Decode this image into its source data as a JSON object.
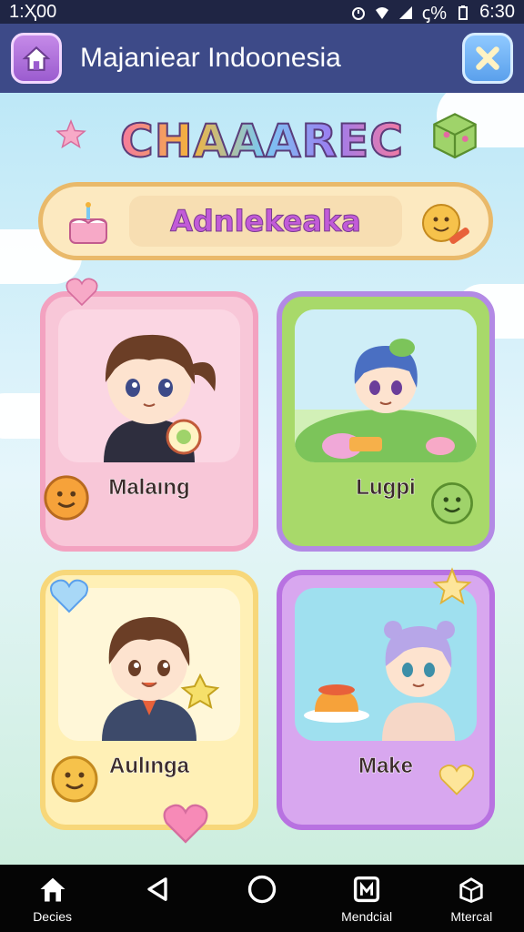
{
  "status_bar": {
    "time": "1:Ҳ00",
    "right_time": "6:30",
    "battery_text": "ꞔ%",
    "icons": [
      "alarm-icon",
      "wifi-icon",
      "signal-icon",
      "battery-icon"
    ]
  },
  "app_bar": {
    "title": "Majaniear Indoonesia",
    "home_icon": "home-icon",
    "close_icon": "close-icon"
  },
  "main": {
    "heading": "CHAAAREC",
    "banner_text": "Adnlekeaka",
    "cards": [
      {
        "name": "Malaıng",
        "bg": "#f8c7d8",
        "border": "#f3a2c0",
        "inner": "#fbd6e3"
      },
      {
        "name": "Lugpi",
        "bg": "#a8d96a",
        "border": "#b38ae5",
        "inner": "#d2f0b7"
      },
      {
        "name": "Aulınga",
        "bg": "#fff0b6",
        "border": "#f7d77a",
        "inner": "#fff7d8"
      },
      {
        "name": "Make",
        "bg": "#d8a7ef",
        "border": "#b872e1",
        "inner": "#9fe0ef"
      }
    ]
  },
  "nav_bar": {
    "items": [
      {
        "label": "Decies",
        "icon": "home-icon"
      },
      {
        "label": "",
        "icon": "back-icon"
      },
      {
        "label": "",
        "icon": "home-circle-icon"
      },
      {
        "label": "Mendcial",
        "icon": "recent-apps-icon"
      },
      {
        "label": "Mtercal",
        "icon": "cube-icon"
      }
    ]
  },
  "colors": {
    "status_bar": "#1f2544",
    "app_bar": "#3d4a88",
    "nav_bar": "#050505"
  }
}
